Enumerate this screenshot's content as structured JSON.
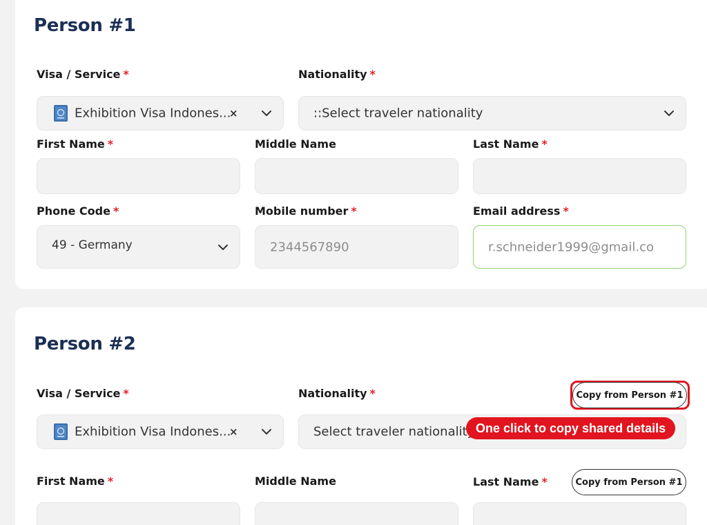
{
  "person1": {
    "title": "Person #1",
    "visa_label": "Visa / Service",
    "visa_value": "Exhibition Visa Indones...",
    "nationality_label": "Nationality",
    "nationality_placeholder": "::Select traveler nationality",
    "first_name_label": "First Name",
    "middle_name_label": "Middle Name",
    "last_name_label": "Last Name",
    "phone_code_label": "Phone Code",
    "phone_code_value": "49 - Germany",
    "mobile_label": "Mobile number",
    "mobile_value": "2344567890",
    "email_label": "Email address",
    "email_value": "r.schneider1999@gmail.co"
  },
  "person2": {
    "title": "Person #2",
    "visa_label": "Visa / Service",
    "visa_value": "Exhibition Visa Indones...",
    "nationality_label": "Nationality",
    "nationality_placeholder": "Select traveler nationality",
    "first_name_label": "First Name",
    "middle_name_label": "Middle Name",
    "last_name_label": "Last Name",
    "copy_button_label": "Copy from Person #1",
    "copy_button_label_2": "Copy from Person #1"
  },
  "required_mark": "*",
  "clear_mark": "×",
  "callout_text": "One click to copy shared details",
  "colors": {
    "title": "#1b2f54",
    "required": "#e0242a",
    "highlight": "#e1141f",
    "focus_border": "#8fd16f",
    "field_bg": "#f2f2f2"
  },
  "icons": {
    "visa": "passport-icon",
    "dropdown": "chevron-down-icon"
  }
}
